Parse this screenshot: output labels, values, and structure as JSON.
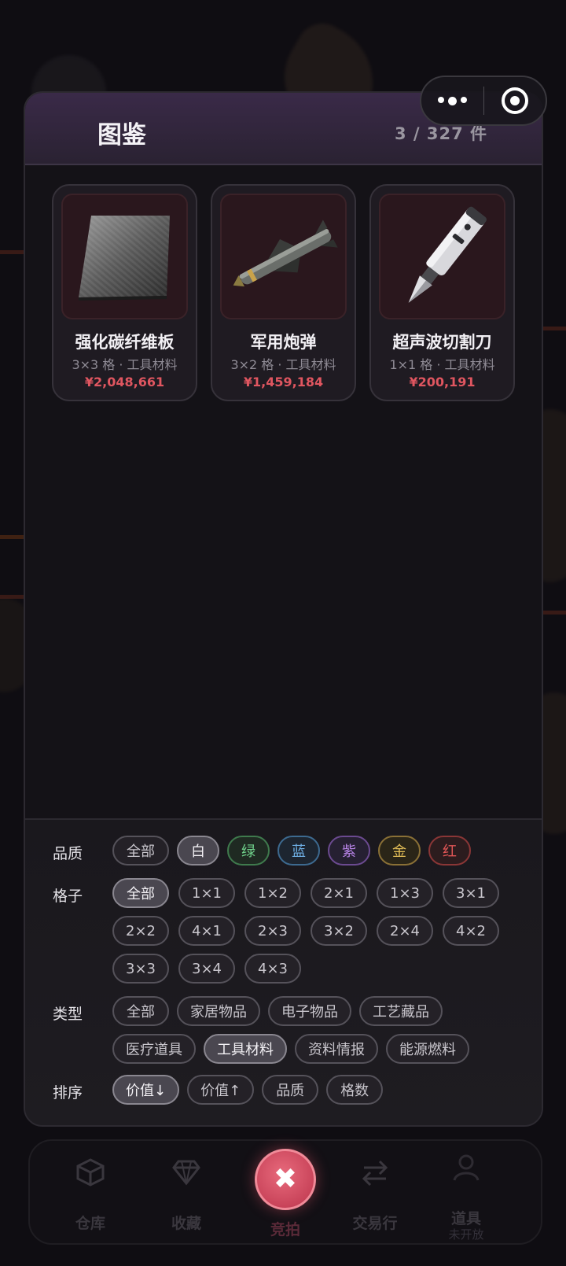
{
  "header": {
    "title": "图鉴",
    "count": "3 / 327 件"
  },
  "items": [
    {
      "name": "强化碳纤维板",
      "meta": "3×3 格 · 工具材料",
      "price": "¥2,048,661",
      "icon": "carbon-plate-icon"
    },
    {
      "name": "军用炮弹",
      "meta": "3×2 格 · 工具材料",
      "price": "¥1,459,184",
      "icon": "missile-icon"
    },
    {
      "name": "超声波切割刀",
      "meta": "1×1 格 · 工具材料",
      "price": "¥200,191",
      "icon": "ultrasonic-cutter-icon"
    }
  ],
  "filters": {
    "quality": {
      "label": "品质",
      "options": [
        "全部",
        "白",
        "绿",
        "蓝",
        "紫",
        "金",
        "红"
      ],
      "selected": "白",
      "colors": {
        "white": "#c9c6cd",
        "green": "#6fd08a",
        "blue": "#6fb0e6",
        "purple": "#b783e6",
        "gold": "#e2bd57",
        "red": "#e05656"
      }
    },
    "grid": {
      "label": "格子",
      "options": [
        "全部",
        "1×1",
        "1×2",
        "2×1",
        "1×3",
        "3×1",
        "2×2",
        "4×1",
        "2×3",
        "3×2",
        "2×4",
        "4×2",
        "3×3",
        "3×4",
        "4×3"
      ],
      "selected": "全部"
    },
    "type": {
      "label": "类型",
      "options": [
        "全部",
        "家居物品",
        "电子物品",
        "工艺藏品",
        "医疗道具",
        "工具材料",
        "资料情报",
        "能源燃料"
      ],
      "selected": "工具材料"
    },
    "sort": {
      "label": "排序",
      "options": [
        "价值↓",
        "价值↑",
        "品质",
        "格数"
      ],
      "selected": "价值↓"
    }
  },
  "nav": {
    "warehouse": "仓库",
    "collection": "收藏",
    "auction": "竞拍",
    "trade": "交易行",
    "items": "道具",
    "items_sub": "未开放",
    "close_symbol": "✖"
  },
  "colors": {
    "accent": "#c9445a",
    "price": "#e05660"
  }
}
